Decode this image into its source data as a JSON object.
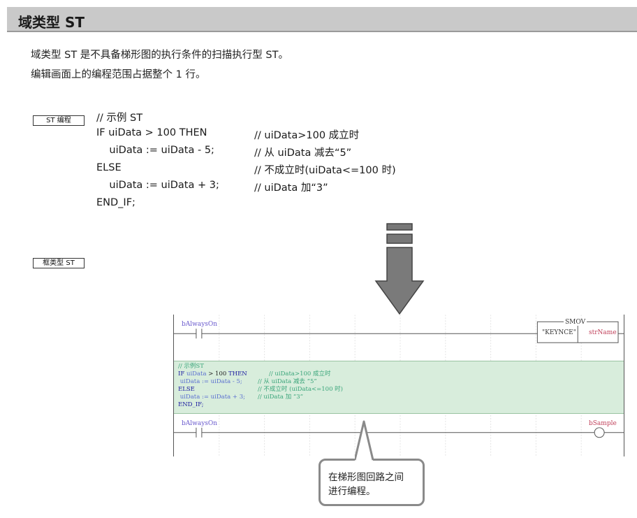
{
  "header": {
    "title": "域类型 ST"
  },
  "intro": {
    "line1": "域类型 ST 是不具备梯形图的执行条件的扫描执行型 ST。",
    "line2": "编辑画面上的编程范围占据整个 1 行。"
  },
  "tags": {
    "st_edit": "ST 编程",
    "frame_st": "框类型 ST"
  },
  "code": {
    "lines": [
      {
        "left": "// 示例 ST",
        "right": ""
      },
      {
        "left": "IF uiData > 100 THEN",
        "right": "// uiData>100 成立时"
      },
      {
        "left": "    uiData := uiData - 5;",
        "right": "// 从 uiData 减去“5”"
      },
      {
        "left": "ELSE",
        "right": "// 不成立时(uiData<=100 时)"
      },
      {
        "left": "    uiData := uiData + 3;",
        "right": "// uiData 加“3”"
      },
      {
        "left": "END_IF;",
        "right": ""
      }
    ]
  },
  "ladder": {
    "contact1_label": "bAlwaysOn",
    "smov_label": "SMOV",
    "smov_arg1": "\"KEYNCE\"",
    "smov_arg2": "strName",
    "contact2_label": "bAlwaysOn",
    "coil_label": "bSample",
    "st_block": {
      "line1": "// 示例ST",
      "line2_kw": "IF",
      "line2_var": "uiData",
      "line2_rest": " > 100 ",
      "line2_then": "THEN",
      "line2_cm": "// uiData>100 成立时",
      "line3_code": " uiData := uiData - 5;",
      "line3_cm": "// 从 uiData 减去 “5”",
      "line4_kw": "ELSE",
      "line4_cm": "// 不成立时 (uiData<=100 时)",
      "line5_code": " uiData := uiData + 3;",
      "line5_cm": "// uiData 加 “3”",
      "line6_kw": "END_IF;"
    }
  },
  "callout": {
    "line1": "在梯形图回路之间",
    "line2": "进行编程。"
  }
}
